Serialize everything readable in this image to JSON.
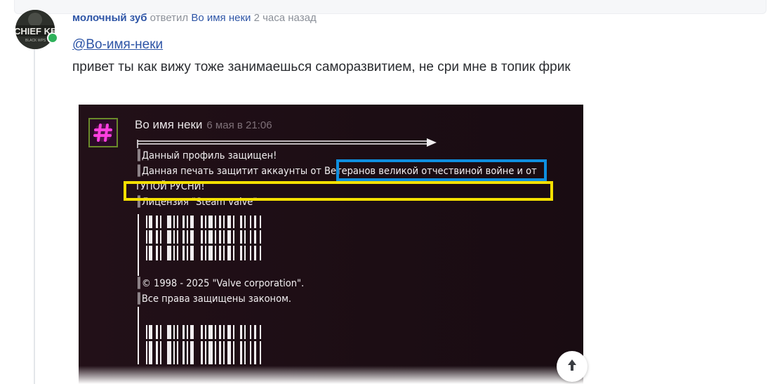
{
  "comment": {
    "author": "молочный зуб",
    "action": "ответил",
    "reply_to": "Во имя неки",
    "time": "2 часа назад",
    "mention": "@Во-имя-неки",
    "text": "привет ты как вижу тоже занимаешься саморазвитием, не сри мне в топик фрик",
    "avatar_text": "CHIEF KE",
    "avatar_subtext": "BLACK WPS",
    "online_color": "#2eb15a"
  },
  "attachment": {
    "profile_name": "Во имя неки",
    "date": "6 мая в 21:06",
    "lines": [
      "║Данный профиль защищен!",
      "║Данная печать защитит аккаунты от Ветеранов великой отчествиной войне и от",
      "ТУПОЙ РУСНИ!",
      "║Лицензия \"Steam valve\""
    ],
    "copyright_lines": [
      "║© 1998 - 2025 \"Valve corporation\".",
      "║Все права защищены законом."
    ],
    "highlight_colors": {
      "blue": "#0f8fe0",
      "yellow": "#f4e000"
    }
  },
  "controls": {
    "scroll_icon": "arrow-up-icon"
  }
}
